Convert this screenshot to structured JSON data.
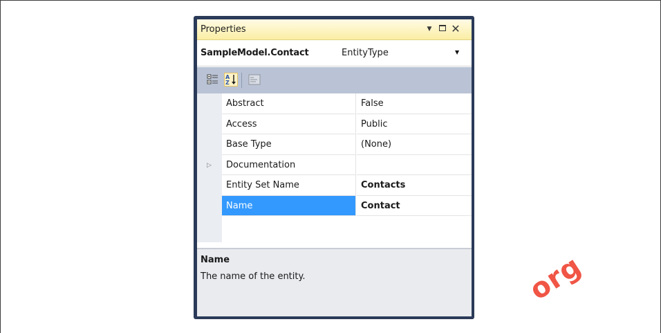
{
  "window": {
    "title": "Properties",
    "dropdown_glyph": "▼",
    "close_glyph": "✕"
  },
  "selector": {
    "object_name": "SampleModel.Contact",
    "object_type": "EntityType",
    "arrow": "▼"
  },
  "toolbar": {
    "buttons": [
      {
        "name": "categorized",
        "icon": "categorized-icon"
      },
      {
        "name": "alphabetical",
        "icon": "sort-alpha-icon",
        "active": true
      },
      {
        "name": "property-pages",
        "icon": "property-pages-icon",
        "enabled": false
      }
    ]
  },
  "properties": [
    {
      "name": "Abstract",
      "value": "False",
      "bold": false
    },
    {
      "name": "Access",
      "value": "Public",
      "bold": false
    },
    {
      "name": "Base Type",
      "value": "(None)",
      "bold": false
    },
    {
      "name": "Documentation",
      "value": "",
      "expandable": true,
      "bold": false
    },
    {
      "name": "Entity Set Name",
      "value": "Contacts",
      "bold": true
    },
    {
      "name": "Name",
      "value": "Contact",
      "bold": true,
      "selected": true
    }
  ],
  "description": {
    "title": "Name",
    "text": "The name of the entity."
  },
  "watermark": {
    "text": "org",
    "color": "#f05545"
  },
  "colors": {
    "selection": "#3399ff",
    "title_bar": "#fbeea4",
    "toolbar": "#b9c3d5",
    "window_border": "#2b3a58"
  }
}
